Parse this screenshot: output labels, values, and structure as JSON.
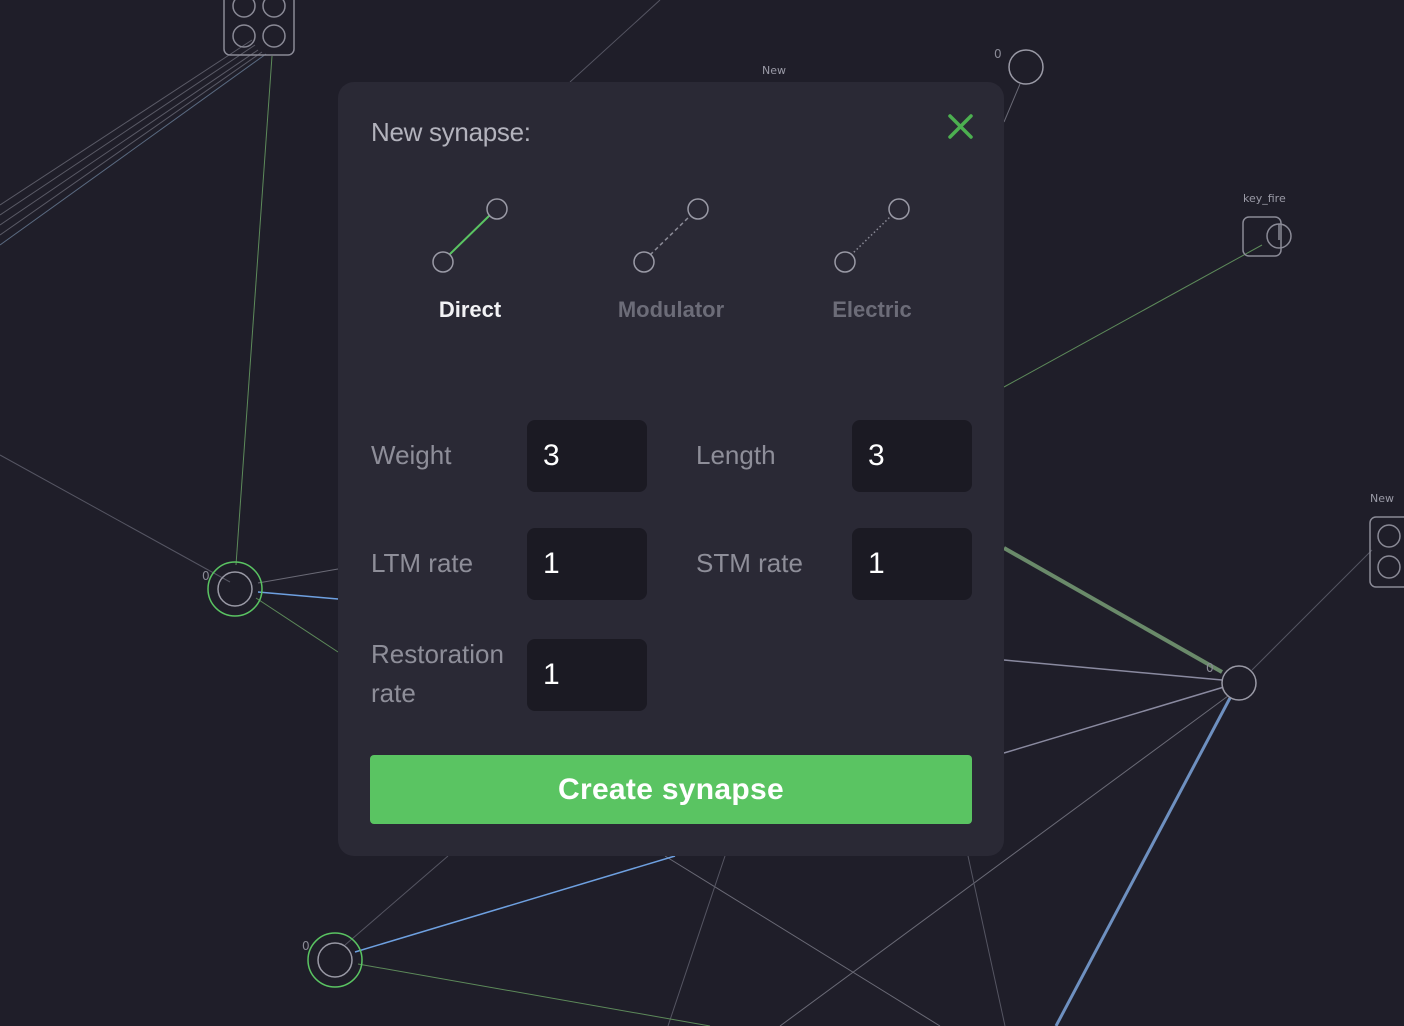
{
  "canvas": {
    "labels": {
      "new_top": "New",
      "key_fire": "key_fire",
      "new_right": "New"
    },
    "counts": {
      "top_right_node": "0",
      "left_node": "0",
      "bottom_left_node": "0",
      "right_hub_node": "0"
    }
  },
  "modal": {
    "title": "New synapse:",
    "close_icon": "close-icon",
    "synapse_types": [
      {
        "label": "Direct",
        "icon": "direct-synapse-icon",
        "selected": true
      },
      {
        "label": "Modulator",
        "icon": "modulator-synapse-icon",
        "selected": false
      },
      {
        "label": "Electric",
        "icon": "electric-synapse-icon",
        "selected": false
      }
    ],
    "fields": {
      "weight": {
        "label": "Weight",
        "value": "3"
      },
      "length": {
        "label": "Length",
        "value": "3"
      },
      "ltm_rate": {
        "label": "LTM rate",
        "value": "1"
      },
      "stm_rate": {
        "label": "STM rate",
        "value": "1"
      },
      "restoration_rate": {
        "label_line1": "Restoration",
        "label_line2": "rate",
        "value": "1"
      }
    },
    "create_button": "Create synapse"
  },
  "colors": {
    "background": "#1f1e29",
    "modal": "#2a2935",
    "input": "#1b1a23",
    "accent_green": "#5ac462",
    "close_green": "#4caf50",
    "link_blue": "#6ea0e0"
  }
}
